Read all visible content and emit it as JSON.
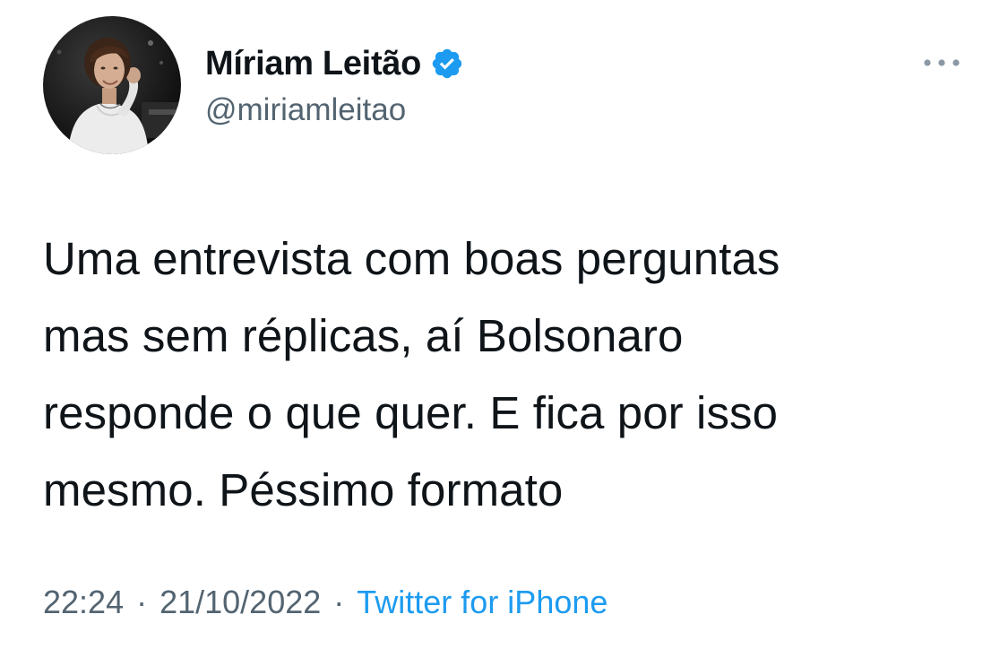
{
  "tweet": {
    "author": {
      "display_name": "Míriam Leitão",
      "handle": "@miriamleitao",
      "verified": true,
      "avatar": "profile-photo"
    },
    "more_icon": "more-horizontal-icon",
    "text_lines": [
      "Uma entrevista com boas perguntas",
      "mas sem réplicas, aí Bolsonaro",
      "responde o que quer. E fica por isso",
      "mesmo. Péssimo formato"
    ],
    "time": "22:24",
    "separator": "·",
    "date": "21/10/2022",
    "source": "Twitter for iPhone"
  },
  "colors": {
    "text_primary": "#0f1419",
    "text_secondary": "#536471",
    "accent_blue": "#1d9bf0"
  }
}
